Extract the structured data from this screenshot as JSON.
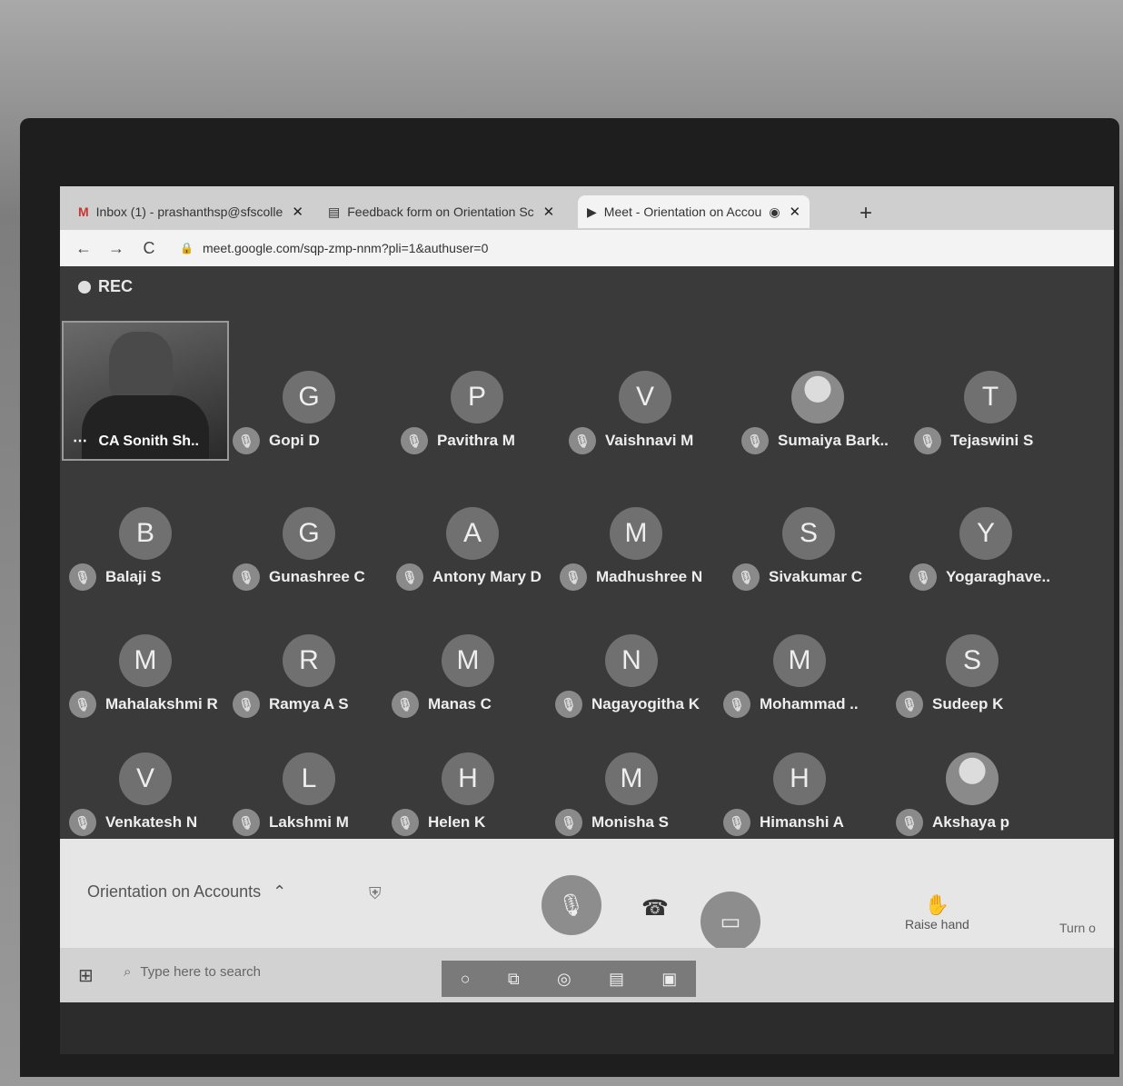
{
  "tabs": [
    {
      "label": "Inbox (1) - prashanthsp@sfscolle",
      "icon": "gmail-icon",
      "close": "✕"
    },
    {
      "label": "Feedback form on Orientation Sc",
      "icon": "form-icon",
      "close": "✕"
    },
    {
      "label": "Meet - Orientation on Accou",
      "icon": "meet-icon",
      "close": "✕"
    }
  ],
  "new_tab": "+",
  "nav": {
    "back": "←",
    "forward": "→",
    "reload": "C"
  },
  "url": "meet.google.com/sqp-zmp-nnm?pli=1&authuser=0",
  "rec": "REC",
  "presenter": {
    "name": "CA Sonith Sh..",
    "more": "⋯"
  },
  "participants": [
    {
      "initial": "G",
      "name": "Gopi D"
    },
    {
      "initial": "P",
      "name": "Pavithra M"
    },
    {
      "initial": "V",
      "name": "Vaishnavi M"
    },
    {
      "initial": "",
      "name": "Sumaiya Bark..",
      "photo": true
    },
    {
      "initial": "T",
      "name": "Tejaswini S"
    },
    {
      "initial": "B",
      "name": "Balaji S"
    },
    {
      "initial": "G",
      "name": "Gunashree C"
    },
    {
      "initial": "A",
      "name": "Antony Mary D"
    },
    {
      "initial": "M",
      "name": "Madhushree N"
    },
    {
      "initial": "S",
      "name": "Sivakumar C"
    },
    {
      "initial": "Y",
      "name": "Yogaraghave.."
    },
    {
      "initial": "M",
      "name": "Mahalakshmi R"
    },
    {
      "initial": "R",
      "name": "Ramya A S"
    },
    {
      "initial": "M",
      "name": "Manas C"
    },
    {
      "initial": "N",
      "name": "Nagayogitha K"
    },
    {
      "initial": "M",
      "name": "Mohammad .."
    },
    {
      "initial": "S",
      "name": "Sudeep K"
    },
    {
      "initial": "V",
      "name": "Venkatesh N"
    },
    {
      "initial": "L",
      "name": "Lakshmi M"
    },
    {
      "initial": "H",
      "name": "Helen K"
    },
    {
      "initial": "M",
      "name": "Monisha S"
    },
    {
      "initial": "H",
      "name": "Himanshi A"
    },
    {
      "initial": "",
      "name": "Akshaya p",
      "photo": true
    }
  ],
  "meeting_name": "Orientation on Accounts",
  "meeting_chevron": "⌃",
  "controls": {
    "raise_hand": "Raise hand",
    "turn": "Turn o"
  },
  "taskbar": {
    "search_placeholder": "Type here to search"
  }
}
